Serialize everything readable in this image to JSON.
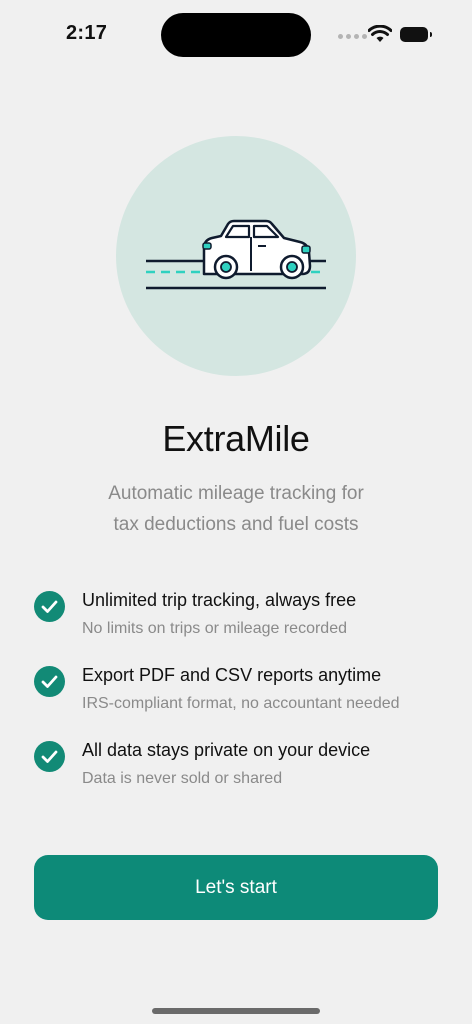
{
  "status_bar": {
    "time": "2:17"
  },
  "app": {
    "title": "ExtraMile",
    "subtitle_line1": "Automatic mileage tracking for",
    "subtitle_line2": "tax deductions and fuel costs"
  },
  "features": [
    {
      "title": "Unlimited trip tracking, always free",
      "subtitle": "No limits on trips or mileage recorded"
    },
    {
      "title": "Export PDF and CSV reports anytime",
      "subtitle": "IRS-compliant format, no accountant needed"
    },
    {
      "title": "All data stays private on your device",
      "subtitle": "Data is never sold or shared"
    }
  ],
  "cta": {
    "label": "Let's start"
  },
  "colors": {
    "accent": "#0d8a78",
    "hero_circle": "#d4e6e1",
    "background": "#f0f0f0",
    "road_dash": "#2fd1c0"
  },
  "icons": {
    "hero": "car-icon",
    "feature_check": "check-icon",
    "status": [
      "cellular-dots-icon",
      "wifi-icon",
      "battery-icon"
    ]
  }
}
